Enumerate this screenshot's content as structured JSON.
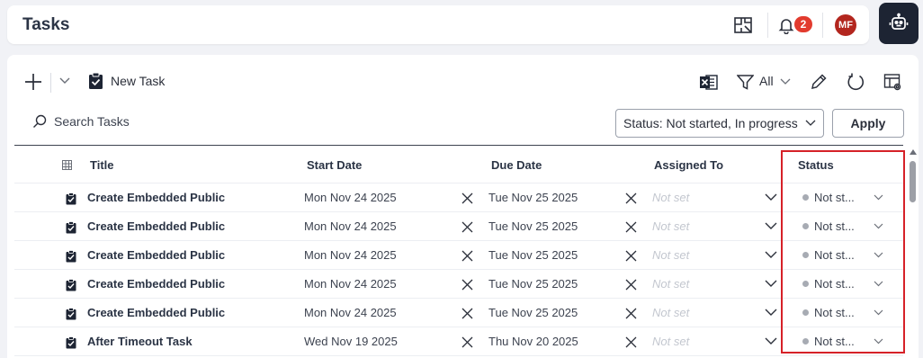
{
  "header": {
    "title": "Tasks",
    "notification_count": "2",
    "avatar_initials": "MF"
  },
  "toolbar": {
    "new_task_label": "New Task",
    "filter_label": "All"
  },
  "search": {
    "placeholder": "Search Tasks"
  },
  "status_filter": {
    "value": "Status: Not started, In progress"
  },
  "apply_label": "Apply",
  "columns": {
    "title": "Title",
    "start_date": "Start Date",
    "due_date": "Due Date",
    "assigned_to": "Assigned To",
    "status": "Status"
  },
  "rows": [
    {
      "title": "Create Embedded Public",
      "start": "Mon Nov 24 2025",
      "due": "Tue Nov 25 2025",
      "assigned": "Not set",
      "status": "Not st..."
    },
    {
      "title": "Create Embedded Public",
      "start": "Mon Nov 24 2025",
      "due": "Tue Nov 25 2025",
      "assigned": "Not set",
      "status": "Not st..."
    },
    {
      "title": "Create Embedded Public",
      "start": "Mon Nov 24 2025",
      "due": "Tue Nov 25 2025",
      "assigned": "Not set",
      "status": "Not st..."
    },
    {
      "title": "Create Embedded Public",
      "start": "Mon Nov 24 2025",
      "due": "Tue Nov 25 2025",
      "assigned": "Not set",
      "status": "Not st..."
    },
    {
      "title": "Create Embedded Public",
      "start": "Mon Nov 24 2025",
      "due": "Tue Nov 25 2025",
      "assigned": "Not set",
      "status": "Not st..."
    },
    {
      "title": "After Timeout Task",
      "start": "Wed Nov 19 2025",
      "due": "Thu Nov 20 2025",
      "assigned": "Not set",
      "status": "Not st..."
    }
  ],
  "colors": {
    "badge": "#e23b2e",
    "avatar": "#b3261e",
    "bot_button": "#1d2433",
    "highlight": "#d62128",
    "status_dot": "#a7abb3"
  }
}
